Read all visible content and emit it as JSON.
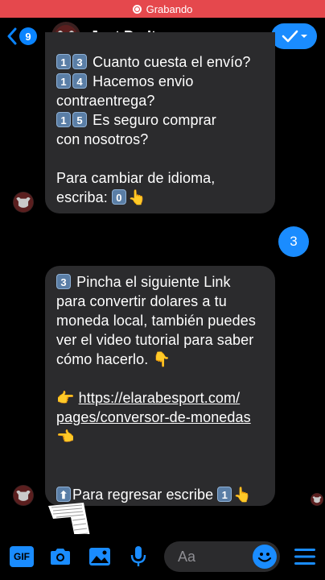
{
  "recording": {
    "label": "Grabando"
  },
  "header": {
    "back_count": "9",
    "title": "Just Do It"
  },
  "messages": {
    "bot1": {
      "lines": [
        {
          "keys": [
            "1",
            "3"
          ],
          "text": "Cuanto cuesta el envío?"
        },
        {
          "keys": [
            "1",
            "4"
          ],
          "text": "Hacemos envio"
        },
        {
          "keys": [],
          "text": "contraentrega?"
        },
        {
          "keys": [
            "1",
            "5"
          ],
          "text": "Es seguro comprar"
        },
        {
          "keys": [],
          "text": "con nosotros?"
        }
      ],
      "lang_line1": "Para cambiar de idioma,",
      "lang_line2_text": "escriba:",
      "lang_key": "0",
      "pointer_emoji": "👆"
    },
    "user1": {
      "text": "3"
    },
    "bot2": {
      "lead_key": "3",
      "lines": [
        "Pincha el siguiente Link",
        "para convertir dolares a tu",
        "moneda local, también puedes",
        "ver el video tutorial para saber",
        "cómo hacerlo."
      ],
      "point_down_emoji": "👇",
      "point_right_emoji": "👉",
      "link_line1": "https://elarabesport.com/",
      "link_line2": "pages/conversor-de-monedas",
      "point_left_emoji": "👈",
      "up_emoji": "⬆",
      "return_text": "Para regresar escribe",
      "return_key": "1",
      "return_pointer": "👆"
    }
  },
  "composer": {
    "placeholder": "Aa",
    "gif_label": "GIF"
  },
  "colors": {
    "accent": "#1a8cff",
    "bubble": "#2b2b2d",
    "recording": "#e5484d"
  }
}
